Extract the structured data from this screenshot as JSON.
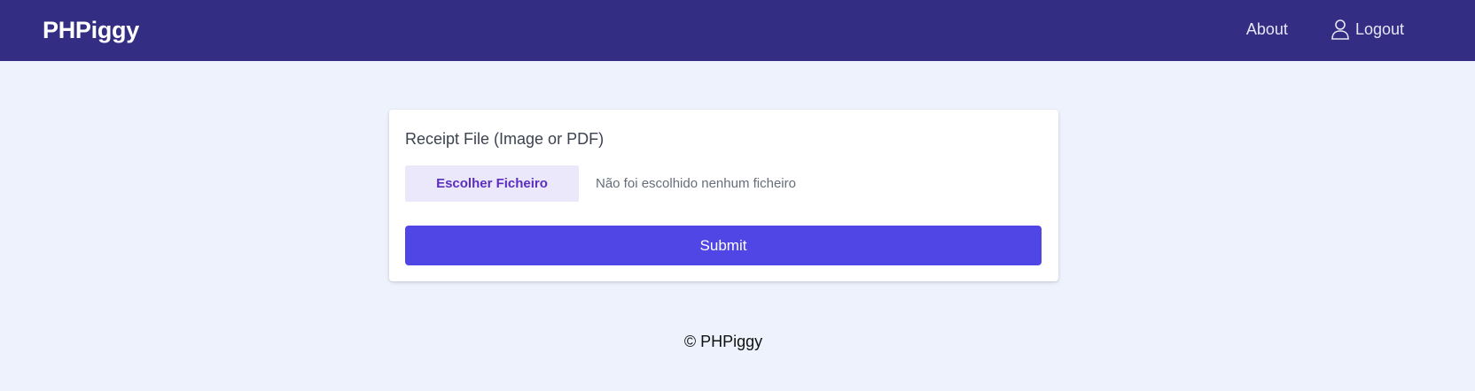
{
  "header": {
    "brand": "PHPiggy",
    "nav": {
      "about_label": "About",
      "logout_label": "Logout",
      "logout_icon": "user-icon"
    }
  },
  "form": {
    "file_label": "Receipt File (Image or PDF)",
    "file_button_label": "Escolher Ficheiro",
    "file_status": "Não foi escolhido nenhum ficheiro",
    "submit_label": "Submit"
  },
  "footer": {
    "copyright": "© PHPiggy"
  },
  "colors": {
    "navbar": "#332d83",
    "page_background": "#eef2fd",
    "primary_button": "#4f46e5",
    "file_button_bg": "#ebe8fc",
    "file_button_text": "#5b2ebf"
  }
}
